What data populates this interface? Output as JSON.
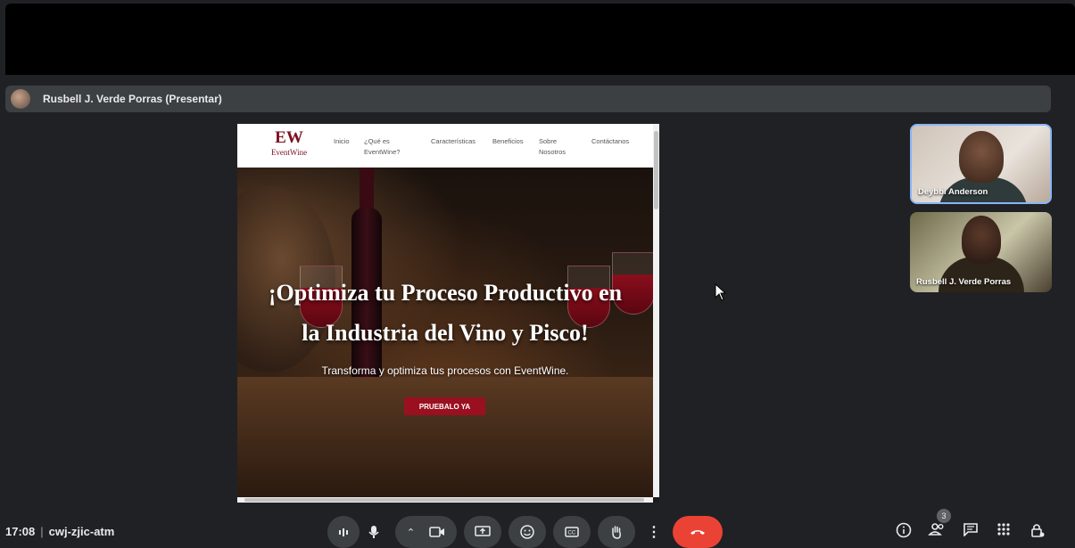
{
  "presenter": {
    "label": "Rusbell J. Verde Porras (Presentar)"
  },
  "website": {
    "logo_mark": "EW",
    "logo_text": "EventWine",
    "nav": [
      "Inicio",
      "¿Qué es EventWine?",
      "Características",
      "Beneficios",
      "Sobre Nosotros",
      "Contáctanos"
    ],
    "hero_title_line1": "¡Optimiza tu Proceso Productivo en",
    "hero_title_line2": "la Industria del Vino y Pisco!",
    "hero_subtitle": "Transforma y optimiza tus procesos con EventWine.",
    "cta_label": "PRUEBALO YA"
  },
  "participants": [
    {
      "name": "Deybbi Anderson"
    },
    {
      "name": "Rusbell J. Verde Porras"
    }
  ],
  "meeting": {
    "time": "17:08",
    "code": "cwj-zjic-atm",
    "participant_count": "3"
  },
  "controls": {
    "icons": [
      "audio-level-icon",
      "microphone-icon",
      "chevron-up-icon",
      "camera-icon",
      "present-screen-icon",
      "emoji-icon",
      "captions-icon",
      "raise-hand-icon",
      "more-options-icon",
      "end-call-icon"
    ],
    "right_icons": [
      "info-icon",
      "people-icon",
      "chat-icon",
      "activities-icon",
      "host-controls-icon"
    ]
  },
  "colors": {
    "brand": "#7a1020",
    "cta": "#9b1020",
    "end_call": "#ea4335",
    "active_speaker_border": "#8ab4f8"
  }
}
